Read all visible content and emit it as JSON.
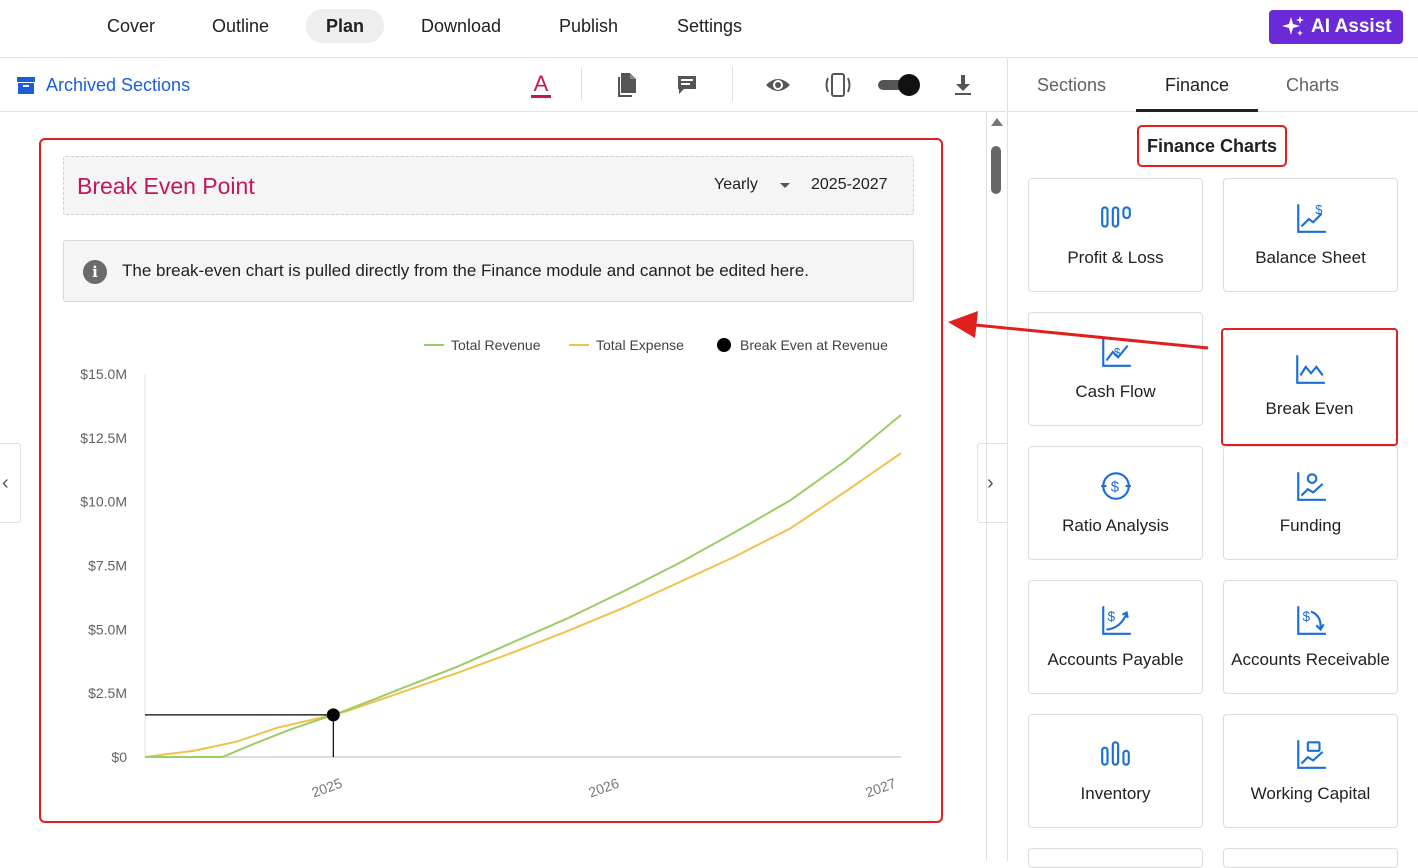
{
  "nav": {
    "items": [
      {
        "label": "Cover",
        "active": false
      },
      {
        "label": "Outline",
        "active": false
      },
      {
        "label": "Plan",
        "active": true
      },
      {
        "label": "Download",
        "active": false
      },
      {
        "label": "Publish",
        "active": false
      },
      {
        "label": "Settings",
        "active": false
      }
    ],
    "ai_assist_label": "AI Assist"
  },
  "toolbar": {
    "archived_label": "Archived Sections",
    "icons": [
      "text-color-icon",
      "document-icon",
      "comment-icon",
      "eye-icon",
      "device-preview-icon",
      "toggle-switch",
      "download-icon"
    ],
    "toggle_on": true
  },
  "break_even": {
    "title": "Break Even Point",
    "period": "Yearly",
    "range": "2025-2027",
    "info_text": "The break-even chart is pulled directly from the Finance module and cannot be edited here."
  },
  "chart_data": {
    "type": "line",
    "title": "",
    "x_ticks": [
      "2025",
      "2026",
      "2027"
    ],
    "y_ticks": [
      "$15.0M",
      "$12.5M",
      "$10.0M",
      "$7.5M",
      "$5.0M",
      "$2.5M",
      "$0"
    ],
    "ylim": [
      0,
      15000000
    ],
    "xlim": [
      2024.27,
      2027
    ],
    "legend_position": "top-right",
    "series": [
      {
        "name": "Total Revenue",
        "color": "#9ccc65",
        "x": [
          2024.27,
          2024.55,
          2024.66,
          2024.8,
          2024.95,
          2025.0,
          2025.2,
          2025.4,
          2025.6,
          2025.8,
          2026.0,
          2026.2,
          2026.4,
          2026.6,
          2026.8,
          2027.0
        ],
        "values": [
          0,
          0,
          500000,
          1100000,
          1650000,
          1850000,
          2700000,
          3550000,
          4500000,
          5450000,
          6500000,
          7600000,
          8800000,
          10050000,
          11600000,
          13400000
        ]
      },
      {
        "name": "Total Expense",
        "color": "#f0c24b",
        "x": [
          2024.27,
          2024.45,
          2024.6,
          2024.75,
          2024.95,
          2025.0,
          2025.2,
          2025.4,
          2025.6,
          2025.8,
          2026.0,
          2026.2,
          2026.4,
          2026.6,
          2026.8,
          2027.0
        ],
        "values": [
          0,
          250000,
          600000,
          1150000,
          1650000,
          1800000,
          2550000,
          3300000,
          4100000,
          4950000,
          5850000,
          6850000,
          7850000,
          8950000,
          10400000,
          11900000
        ]
      }
    ],
    "break_even": {
      "name": "Break Even at Revenue",
      "x": 2024.95,
      "value": 1650000,
      "color": "#000000"
    }
  },
  "panel": {
    "tabs": [
      {
        "label": "Sections",
        "active": false
      },
      {
        "label": "Finance",
        "active": true
      },
      {
        "label": "Charts",
        "active": false
      }
    ],
    "section_title": "Finance Charts",
    "cards": [
      {
        "label": "Profit & Loss",
        "icon": "profit-loss-icon"
      },
      {
        "label": "Balance Sheet",
        "icon": "balance-sheet-icon"
      },
      {
        "label": "Cash Flow",
        "icon": "cash-flow-icon"
      },
      {
        "label": "Break Even",
        "icon": "break-even-icon",
        "highlighted": true
      },
      {
        "label": "Ratio Analysis",
        "icon": "ratio-analysis-icon"
      },
      {
        "label": "Funding",
        "icon": "funding-icon"
      },
      {
        "label": "Accounts Payable",
        "icon": "accounts-payable-icon"
      },
      {
        "label": "Accounts Receivable",
        "icon": "accounts-receivable-icon"
      },
      {
        "label": "Inventory",
        "icon": "inventory-icon"
      },
      {
        "label": "Working Capital",
        "icon": "working-capital-icon"
      }
    ]
  },
  "colors": {
    "accent": "#6a2ad8",
    "link": "#1a5fd6",
    "title": "#c2185b",
    "highlight": "#e0201d",
    "icon_blue": "#1a6ed8"
  }
}
